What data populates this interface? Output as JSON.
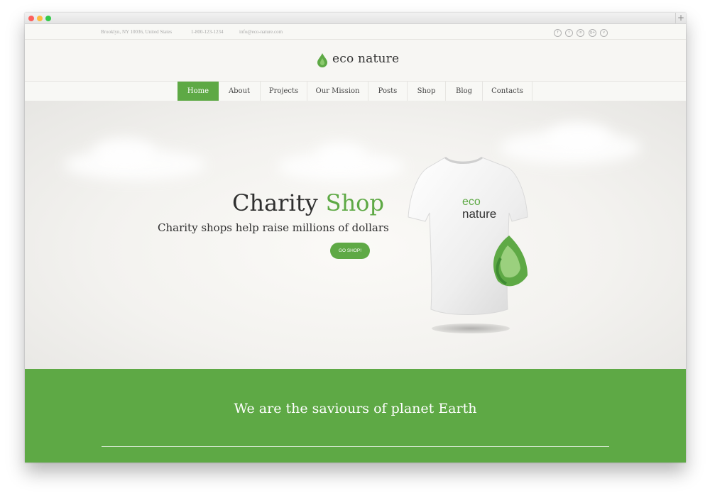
{
  "topbar": {
    "address": "Brooklyn, NY 10036, United States",
    "phone": "1-800-123-1234",
    "email": "info@eco-nature.com",
    "social_icons": [
      "facebook-icon",
      "twitter-icon",
      "linkedin-icon",
      "google-plus-icon",
      "vimeo-icon"
    ]
  },
  "brand": {
    "name": "eco nature",
    "icon": "leaf-drop-icon",
    "accent_color": "#5ea945"
  },
  "nav": {
    "items": [
      {
        "label": "Home",
        "active": true
      },
      {
        "label": "About"
      },
      {
        "label": "Projects"
      },
      {
        "label": "Our Mission"
      },
      {
        "label": "Posts"
      },
      {
        "label": "Shop"
      },
      {
        "label": "Blog"
      },
      {
        "label": "Contacts"
      }
    ]
  },
  "hero": {
    "title_part1": "Charity",
    "title_part2": "Shop",
    "subtitle": "Charity shops help raise millions of dollars",
    "cta_label": "GO SHOP!",
    "tshirt_text_line1": "eco",
    "tshirt_text_line2": "nature"
  },
  "band": {
    "title": "We are the saviours of planet Earth",
    "background_color": "#5ea945"
  }
}
